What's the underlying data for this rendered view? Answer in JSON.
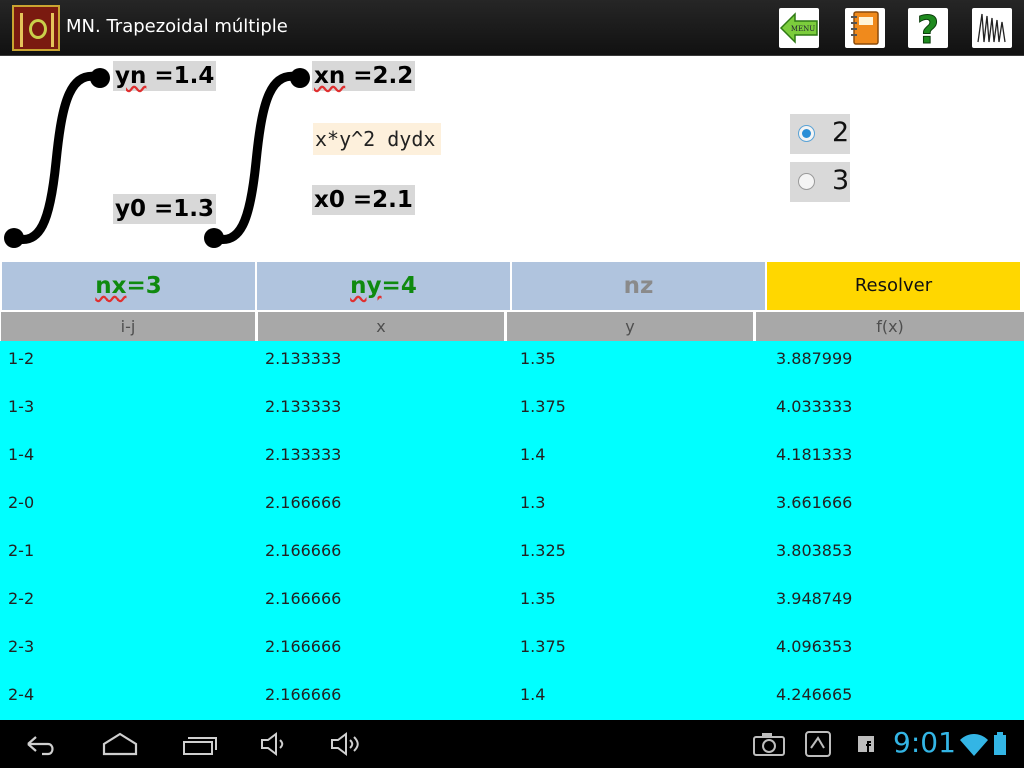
{
  "app": {
    "title": "MN. Trapezoidal múltiple"
  },
  "toolbar": {
    "menu_label": "MENU"
  },
  "integral": {
    "outer_upper": {
      "var": "yn",
      "rest": " =1.4"
    },
    "outer_lower": "y0 =1.3",
    "inner_upper": {
      "var": "xn",
      "rest": " =2.2"
    },
    "inner_lower": "x0 =2.1",
    "function": "x*y^2  dydx"
  },
  "dimension_options": [
    {
      "label": "2",
      "checked": true
    },
    {
      "label": "3",
      "checked": false
    }
  ],
  "params": {
    "nx": {
      "var": "nx",
      "rest": "=3"
    },
    "ny": {
      "var": "ny",
      "rest": "=4"
    },
    "nz": "nz",
    "solve_label": "Resolver"
  },
  "table": {
    "headers": [
      "i-j",
      "x",
      "y",
      "f(x)"
    ],
    "rows": [
      [
        "1-2",
        "2.133333",
        "1.35",
        "3.887999"
      ],
      [
        "1-3",
        "2.133333",
        "1.375",
        "4.033333"
      ],
      [
        "1-4",
        "2.133333",
        "1.4",
        "4.181333"
      ],
      [
        "2-0",
        "2.166666",
        "1.3",
        "3.661666"
      ],
      [
        "2-1",
        "2.166666",
        "1.325",
        "3.803853"
      ],
      [
        "2-2",
        "2.166666",
        "1.35",
        "3.948749"
      ],
      [
        "2-3",
        "2.166666",
        "1.375",
        "4.096353"
      ],
      [
        "2-4",
        "2.166666",
        "1.4",
        "4.246665"
      ]
    ]
  },
  "status": {
    "time": "9:01"
  },
  "colors": {
    "table_bg": "#00ffff",
    "param_bg": "#b0c4de",
    "solve_bg": "#ffd700",
    "param_text": "#0f8a0f",
    "clock": "#33b5e5"
  }
}
